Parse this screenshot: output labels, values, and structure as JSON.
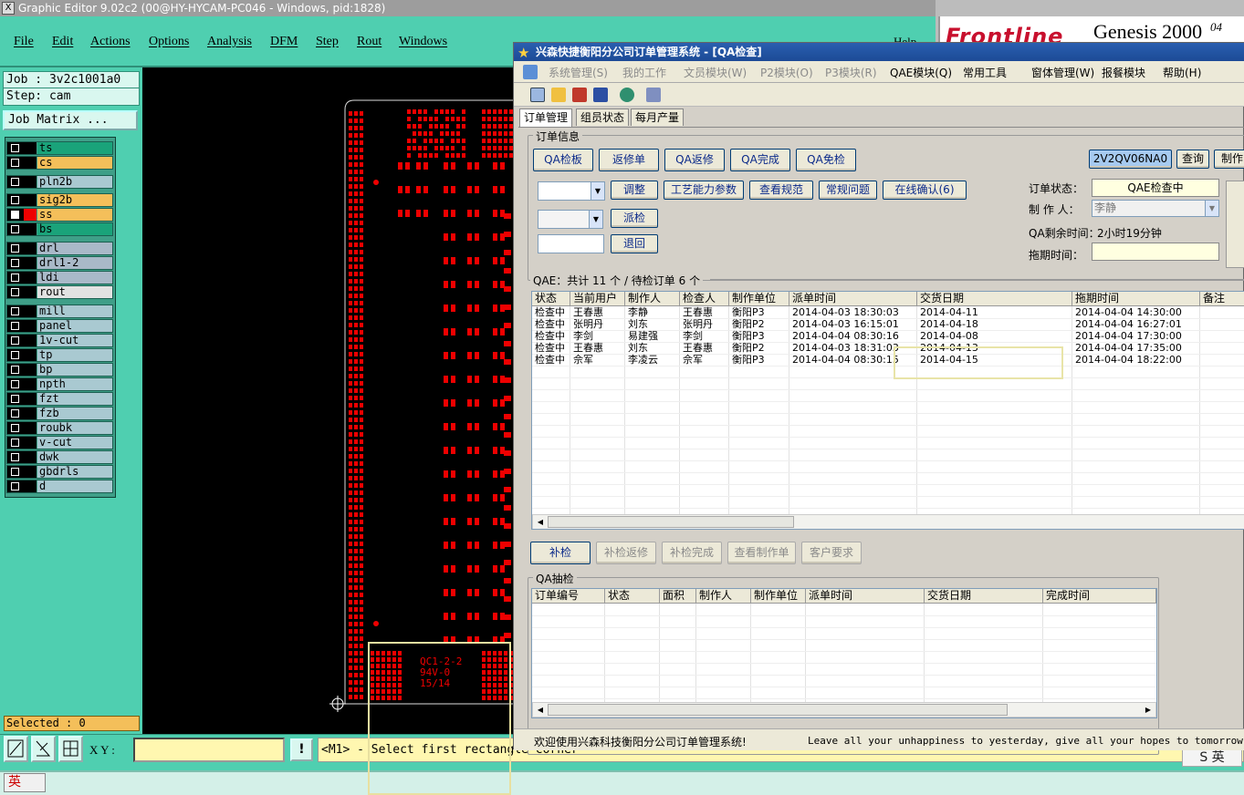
{
  "ge": {
    "title": "Graphic Editor 9.02c2 (00@HY-HYCAM-PC046 - Windows, pid:1828)",
    "menu": [
      "File",
      "Edit",
      "Actions",
      "Options",
      "Analysis",
      "DFM",
      "Step",
      "Rout",
      "Windows"
    ],
    "help_cut": "Help",
    "brand": {
      "frontline": "Frontline",
      "genesis": "Genesis 2000",
      "version": "04"
    },
    "job": "Job : 3v2c1001a0",
    "step": "Step: cam",
    "job_matrix": "Job Matrix ...",
    "layers": [
      {
        "name": "ts",
        "color": "#1aa37a"
      },
      {
        "name": "cs",
        "color": "#f4bf5a"
      },
      {
        "name": "pln2b",
        "color": "#a9c9d1"
      },
      {
        "name": "sig2b",
        "color": "#f4bf5a"
      },
      {
        "name": "ss",
        "color": "#f4bf5a"
      },
      {
        "name": "bs",
        "color": "#1aa37a"
      },
      {
        "name": "drl",
        "color": "#a9b9c8"
      },
      {
        "name": "drl1-2",
        "color": "#a9b9c8"
      },
      {
        "name": "ldi",
        "color": "#a9b9c8"
      },
      {
        "name": "rout",
        "color": "#e2e2e2"
      },
      {
        "name": "mill",
        "color": "#a9c9d1"
      },
      {
        "name": "panel",
        "color": "#a9c9d1"
      },
      {
        "name": "1v-cut",
        "color": "#a9c9d1"
      },
      {
        "name": "tp",
        "color": "#a9c9d1"
      },
      {
        "name": "bp",
        "color": "#a9c9d1"
      },
      {
        "name": "npth",
        "color": "#a9c9d1"
      },
      {
        "name": "fzt",
        "color": "#a9c9d1"
      },
      {
        "name": "fzb",
        "color": "#a9c9d1"
      },
      {
        "name": "roubk",
        "color": "#a9c9d1"
      },
      {
        "name": "v-cut",
        "color": "#a9c9d1"
      },
      {
        "name": "dwk",
        "color": "#a9c9d1"
      },
      {
        "name": "gbdrls",
        "color": "#a9c9d1"
      },
      {
        "name": "d",
        "color": "#a9c9d1"
      }
    ],
    "selected": "Selected : 0",
    "xy_label": "X Y :",
    "status_msg": "<M1> - Select first rectangle corner",
    "board_text": [
      "QC1-2-2",
      "94V-0",
      "15/14"
    ],
    "ime_left": "英",
    "ime_right": "S 英"
  },
  "win": {
    "title": "兴森快捷衡阳分公司订单管理系统 - [QA检查]",
    "menu": [
      {
        "label": "系统管理(S)",
        "enabled": false
      },
      {
        "label": "我的工作",
        "enabled": false
      },
      {
        "label": "文员模块(W)",
        "enabled": false
      },
      {
        "label": "P2模块(O)",
        "enabled": false
      },
      {
        "label": "P3模块(R)",
        "enabled": false
      },
      {
        "label": "QAE模块(Q)",
        "enabled": true
      },
      {
        "label": "常用工具",
        "enabled": true
      },
      {
        "label": "窗体管理(W)",
        "enabled": true
      },
      {
        "label": "报餐模块",
        "enabled": true
      },
      {
        "label": "帮助(H)",
        "enabled": true
      }
    ],
    "tabs": [
      "订单管理",
      "组员状态",
      "每月产量"
    ],
    "order_info_title": "订单信息",
    "buttons_row1": [
      "QA检板",
      "返修单",
      "QA返修",
      "QA完成",
      "QA免检"
    ],
    "buttons_row2": [
      "调整",
      "工艺能力参数",
      "查看规范",
      "常规问题",
      "在线确认(6)"
    ],
    "dispatch_btn": "派检",
    "return_btn": "退回",
    "order_no": "2V2QV06NA0",
    "query_btn": "查询",
    "make_btn": "制作",
    "status_label": "订单状态：",
    "status_value": "QAE检查中",
    "maker_label": "制 作 人：",
    "maker_value": "李静",
    "remain_label": "QA剩余时间：",
    "remain_value": "2小时19分钟",
    "delay_label": "拖期时间：",
    "qae_summary": "QAE：共计 11 个 / 待检订单 6 个",
    "grid1": {
      "headers": [
        "状态",
        "当前用户",
        "制作人",
        "检查人",
        "制作单位",
        "派单时间",
        "交货日期",
        "拖期时间",
        "备注"
      ],
      "rows": [
        [
          "检查中",
          "王春惠",
          "李静",
          "王春惠",
          "衡阳P3",
          "2014-04-03 18:30:03",
          "2014-04-11",
          "2014-04-04 14:30:00",
          ""
        ],
        [
          "检查中",
          "张明丹",
          "刘东",
          "张明丹",
          "衡阳P2",
          "2014-04-03 16:15:01",
          "2014-04-18",
          "2014-04-04 16:27:01",
          ""
        ],
        [
          "检查中",
          "李剑",
          "易建强",
          "李剑",
          "衡阳P3",
          "2014-04-04 08:30:16",
          "2014-04-08",
          "2014-04-04 17:30:00",
          ""
        ],
        [
          "检查中",
          "王春惠",
          "刘东",
          "王春惠",
          "衡阳P2",
          "2014-04-03 18:31:03",
          "2014-04-13",
          "2014-04-04 17:35:00",
          ""
        ],
        [
          "检查中",
          "佘军",
          "李凌云",
          "佘军",
          "衡阳P3",
          "2014-04-04 08:30:15",
          "2014-04-15",
          "2014-04-04 18:22:00",
          ""
        ]
      ]
    },
    "buttons_row3": [
      {
        "label": "补检",
        "enabled": true
      },
      {
        "label": "补检返修",
        "enabled": false
      },
      {
        "label": "补检完成",
        "enabled": false
      },
      {
        "label": "查看制作单",
        "enabled": false
      },
      {
        "label": "客户要求",
        "enabled": false
      }
    ],
    "qa_sample_title": "QA抽检",
    "grid2": {
      "headers": [
        "订单编号",
        "状态",
        "面积",
        "制作人",
        "制作单位",
        "派单时间",
        "交货日期",
        "完成时间"
      ]
    },
    "status_welcome": "欢迎使用兴森科技衡阳分公司订单管理系统!",
    "status_quote": "Leave all your unhappiness to yesterday, give all your hopes to tomorrow, and do"
  }
}
